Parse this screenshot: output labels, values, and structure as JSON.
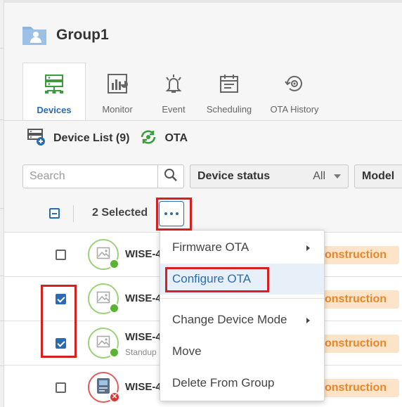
{
  "header": {
    "title": "Group1",
    "folder_icon": "folder-user-icon"
  },
  "tabs": [
    {
      "label": "Devices",
      "icon": "devices-icon",
      "active": true
    },
    {
      "label": "Monitor",
      "icon": "monitor-chart-icon",
      "active": false
    },
    {
      "label": "Event",
      "icon": "bell-icon",
      "active": false
    },
    {
      "label": "Scheduling",
      "icon": "calendar-icon",
      "active": false
    },
    {
      "label": "OTA History",
      "icon": "ota-history-icon",
      "active": false
    }
  ],
  "subhead": {
    "device_list": "Device List (9)",
    "ota": "OTA"
  },
  "filters": {
    "search_placeholder": "Search",
    "device_status_label": "Device status",
    "device_status_value": "All",
    "model_label": "Model"
  },
  "selection": {
    "selected_text": "2 Selected"
  },
  "rows": [
    {
      "name": "WISE-4",
      "sub": "",
      "checked": false,
      "status": "online",
      "badge": "onstruction"
    },
    {
      "name": "WISE-4",
      "sub": "",
      "checked": true,
      "status": "online",
      "badge": "onstruction"
    },
    {
      "name": "WISE-4",
      "sub": "Standup",
      "checked": true,
      "status": "online",
      "badge": "onstruction"
    },
    {
      "name": "WISE-4",
      "sub": "",
      "checked": false,
      "status": "error",
      "badge": "onstruction"
    }
  ],
  "menu": {
    "firmware_ota": "Firmware OTA",
    "configure_ota": "Configure OTA",
    "change_device_mode": "Change Device Mode",
    "move": "Move",
    "delete_from_group": "Delete From Group"
  },
  "colors": {
    "accent": "#2b6cb0",
    "highlight_red": "#d62020",
    "badge_bg": "#fde4c8",
    "badge_text": "#e8862a",
    "online": "#57b52f"
  }
}
